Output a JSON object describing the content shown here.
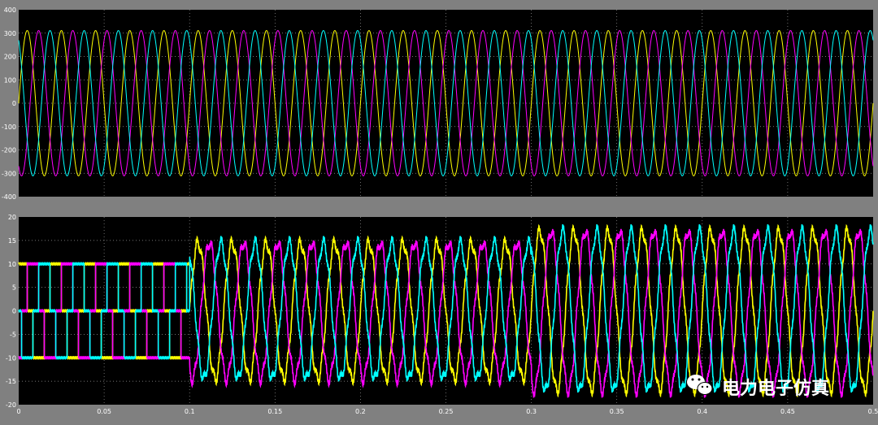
{
  "chart_data": [
    {
      "type": "line",
      "title": "",
      "xlim": [
        0,
        0.5
      ],
      "ylim": [
        -400,
        400
      ],
      "x_ticks": [
        0,
        0.05,
        0.1,
        0.15,
        0.2,
        0.25,
        0.3,
        0.35,
        0.4,
        0.45,
        0.5
      ],
      "y_ticks": [
        -400,
        -300,
        -200,
        -100,
        0,
        100,
        200,
        300,
        400
      ],
      "grid": true,
      "background": "#000000",
      "description_of_series": "three-phase sinusoids",
      "frequency_hz": 50,
      "series": [
        {
          "color": "#ffff00",
          "amplitude": 311,
          "phase_deg": 0
        },
        {
          "color": "#ff00ff",
          "amplitude": 311,
          "phase_deg": -120
        },
        {
          "color": "#00ffff",
          "amplitude": 311,
          "phase_deg": 120
        }
      ]
    },
    {
      "type": "line",
      "title": "",
      "xlim": [
        0,
        0.5
      ],
      "ylim": [
        -20,
        20
      ],
      "x_ticks": [
        0,
        0.05,
        0.1,
        0.15,
        0.2,
        0.25,
        0.3,
        0.35,
        0.4,
        0.45,
        0.5
      ],
      "x_tick_labels": [
        "0",
        "0.05",
        "0.1",
        "0.15",
        "0.2",
        "0.25",
        "0.3",
        "0.35",
        "0.4",
        "0.45",
        "0.5"
      ],
      "y_ticks": [
        -20,
        -15,
        -10,
        -5,
        0,
        5,
        10,
        15,
        20
      ],
      "grid": true,
      "background": "#000000",
      "frequency_hz": 50,
      "segments": [
        {
          "t_start": 0,
          "t_end": 0.1,
          "shape": "six-step square wave",
          "amplitude": 10
        },
        {
          "t_start": 0.1,
          "t_end": 0.3,
          "shape": "sinusoid with ripple",
          "amplitude": 14.5
        },
        {
          "t_start": 0.3,
          "t_end": 0.5,
          "shape": "sinusoid with ripple",
          "amplitude": 17
        }
      ],
      "series": [
        {
          "color": "#ffff00",
          "phase_deg": 0
        },
        {
          "color": "#ff00ff",
          "phase_deg": -120
        },
        {
          "color": "#00ffff",
          "phase_deg": 120
        }
      ]
    }
  ],
  "watermark": {
    "text": "电力电子仿真",
    "icon": "wechat-icon"
  }
}
